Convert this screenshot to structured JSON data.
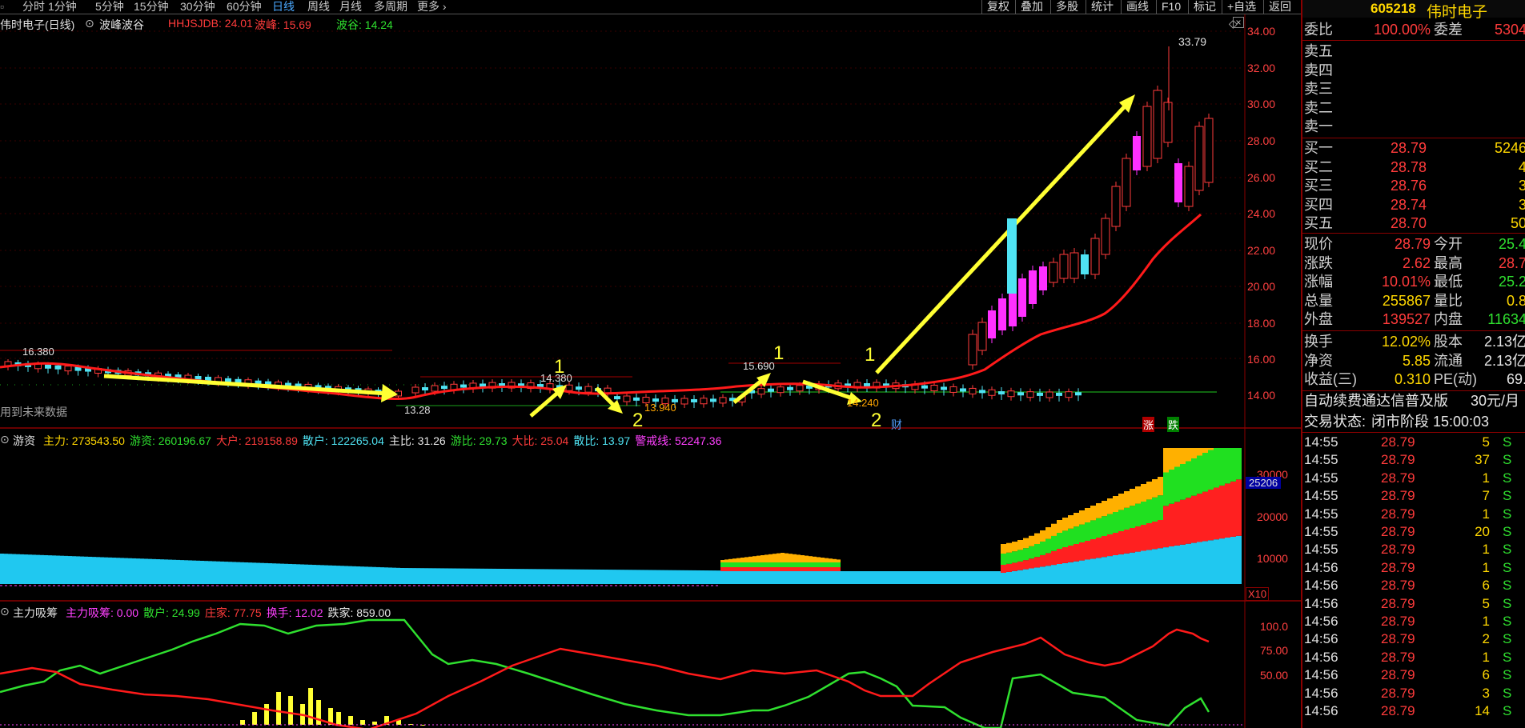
{
  "toolbar": {
    "periods": [
      "分时",
      "1分钟",
      "5分钟",
      "15分钟",
      "30分钟",
      "60分钟",
      "日线",
      "周线",
      "月线",
      "多周期",
      "更多"
    ],
    "active_period": "日线",
    "right_buttons": [
      "复权",
      "叠加",
      "多股",
      "统计",
      "画线",
      "F10",
      "标记",
      "+自选",
      "返回"
    ]
  },
  "main_chart": {
    "title": "伟时电子(日线)",
    "indicator_name": "波峰波谷",
    "hhjsjdb_label": "HHJSJDB: 24.01",
    "peak_label": "波峰: 15.69",
    "trough_label": "波谷: 14.24",
    "note": "用到未来数据",
    "y_ticks": [
      "34.00",
      "32.00",
      "30.00",
      "28.00",
      "26.00",
      "24.00",
      "22.00",
      "20.00",
      "18.00",
      "16.00",
      "14.00"
    ],
    "price_labels": [
      "16.380",
      "14.380",
      "13.28",
      "13.940",
      "15.690",
      "14.240",
      "33.79"
    ],
    "wave_marks": [
      "1",
      "2",
      "1",
      "2",
      "1",
      "2"
    ],
    "tags": [
      "财",
      "涨",
      "跌"
    ]
  },
  "capital_panel": {
    "name": "游资",
    "items": [
      {
        "label": "主力: 273543.50",
        "color": "#ffd700"
      },
      {
        "label": "游资: 260196.67",
        "color": "#2fe02f"
      },
      {
        "label": "大户: 219158.89",
        "color": "#ff3b3b"
      },
      {
        "label": "散户: 122265.04",
        "color": "#4fe3f3"
      },
      {
        "label": "主比: 31.26",
        "color": "#e8e8e8"
      },
      {
        "label": "游比: 29.73",
        "color": "#2fe02f"
      },
      {
        "label": "大比: 25.04",
        "color": "#ff3b3b"
      },
      {
        "label": "散比: 13.97",
        "color": "#4fe3f3"
      },
      {
        "label": "警戒线: 52247.36",
        "color": "#ff40ff"
      }
    ],
    "y_ticks": [
      "30000",
      "20000",
      "10000"
    ],
    "current_value": "25206",
    "multiplier": "X10"
  },
  "chip_panel": {
    "name": "主力吸筹",
    "items": [
      {
        "label": "主力吸筹: 0.00",
        "color": "#ff40ff"
      },
      {
        "label": "散户: 24.99",
        "color": "#2fe02f"
      },
      {
        "label": "庄家: 77.75",
        "color": "#ff3b3b"
      },
      {
        "label": "换手: 12.02",
        "color": "#ff40ff"
      },
      {
        "label": "跌家: 859.00",
        "color": "#e8e8e8"
      }
    ],
    "y_ticks": [
      "100.0",
      "75.00",
      "50.00"
    ]
  },
  "quote": {
    "code": "605218",
    "name": "伟时电子",
    "weibi_label": "委比",
    "weibi": "100.00%",
    "weicha_label": "委差",
    "weicha": "5304",
    "asks": [
      {
        "label": "卖五"
      },
      {
        "label": "卖四"
      },
      {
        "label": "卖三"
      },
      {
        "label": "卖二"
      },
      {
        "label": "卖一"
      }
    ],
    "bids": [
      {
        "label": "买一",
        "price": "28.79",
        "vol": "5246"
      },
      {
        "label": "买二",
        "price": "28.78",
        "vol": "4"
      },
      {
        "label": "买三",
        "price": "28.76",
        "vol": "3"
      },
      {
        "label": "买四",
        "price": "28.74",
        "vol": "3"
      },
      {
        "label": "买五",
        "price": "28.70",
        "vol": "50"
      }
    ],
    "stats": [
      {
        "l1": "现价",
        "v1": "28.79",
        "c1": "red",
        "l2": "今开",
        "v2": "25.4",
        "c2": "green"
      },
      {
        "l1": "涨跌",
        "v1": "2.62",
        "c1": "red",
        "l2": "最高",
        "v2": "28.7",
        "c2": "red"
      },
      {
        "l1": "涨幅",
        "v1": "10.01%",
        "c1": "red",
        "l2": "最低",
        "v2": "25.2",
        "c2": "green"
      },
      {
        "l1": "总量",
        "v1": "255867",
        "c1": "yellow",
        "l2": "量比",
        "v2": "0.8",
        "c2": "yellow"
      },
      {
        "l1": "外盘",
        "v1": "139527",
        "c1": "red",
        "l2": "内盘",
        "v2": "11634",
        "c2": "green"
      }
    ],
    "stats2": [
      {
        "l1": "换手",
        "v1": "12.02%",
        "c1": "yellow",
        "l2": "股本",
        "v2": "2.13亿",
        "c2": "white"
      },
      {
        "l1": "净资",
        "v1": "5.85",
        "c1": "yellow",
        "l2": "流通",
        "v2": "2.13亿",
        "c2": "white"
      },
      {
        "l1": "收益(三)",
        "v1": "0.310",
        "c1": "yellow",
        "l2": "PE(动)",
        "v2": "69.",
        "c2": "white"
      }
    ],
    "ad_text": "自动续费通达信普及版",
    "ad_price": "30元/月",
    "status_label": "交易状态:",
    "status": "闭市阶段 15:00:03",
    "ticks": [
      {
        "t": "14:55",
        "p": "28.79",
        "v": "5",
        "s": "S"
      },
      {
        "t": "14:55",
        "p": "28.79",
        "v": "37",
        "s": "S"
      },
      {
        "t": "14:55",
        "p": "28.79",
        "v": "1",
        "s": "S"
      },
      {
        "t": "14:55",
        "p": "28.79",
        "v": "7",
        "s": "S"
      },
      {
        "t": "14:55",
        "p": "28.79",
        "v": "1",
        "s": "S"
      },
      {
        "t": "14:55",
        "p": "28.79",
        "v": "20",
        "s": "S"
      },
      {
        "t": "14:55",
        "p": "28.79",
        "v": "1",
        "s": "S"
      },
      {
        "t": "14:56",
        "p": "28.79",
        "v": "1",
        "s": "S"
      },
      {
        "t": "14:56",
        "p": "28.79",
        "v": "6",
        "s": "S"
      },
      {
        "t": "14:56",
        "p": "28.79",
        "v": "5",
        "s": "S"
      },
      {
        "t": "14:56",
        "p": "28.79",
        "v": "1",
        "s": "S"
      },
      {
        "t": "14:56",
        "p": "28.79",
        "v": "2",
        "s": "S"
      },
      {
        "t": "14:56",
        "p": "28.79",
        "v": "1",
        "s": "S"
      },
      {
        "t": "14:56",
        "p": "28.79",
        "v": "6",
        "s": "S"
      },
      {
        "t": "14:56",
        "p": "28.79",
        "v": "3",
        "s": "S"
      },
      {
        "t": "14:56",
        "p": "28.79",
        "v": "14",
        "s": "S"
      }
    ]
  },
  "colors": {
    "up": "#ff3b3b",
    "down": "#4fe3f3",
    "magenta": "#ff30ff",
    "ma": "#ff1a1a",
    "arrow": "#ffff33"
  }
}
